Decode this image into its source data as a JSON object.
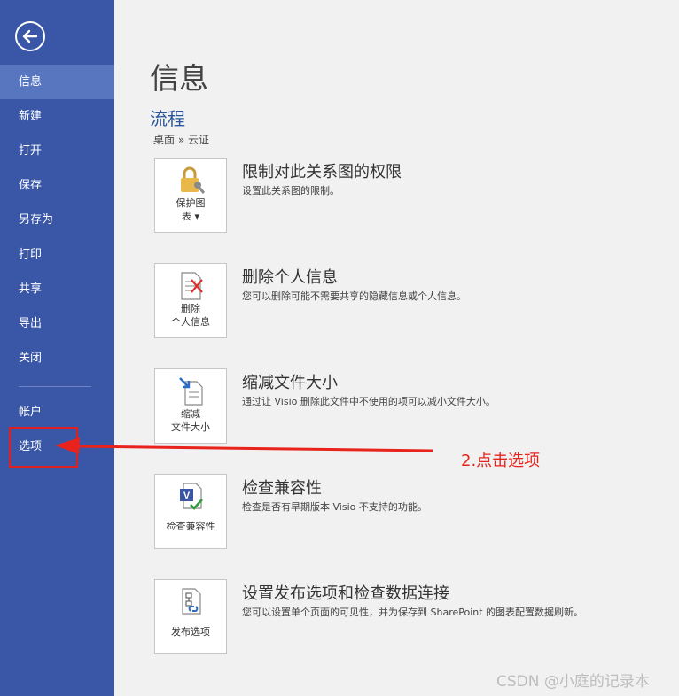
{
  "sidebar": {
    "items": [
      {
        "label": "信息"
      },
      {
        "label": "新建"
      },
      {
        "label": "打开"
      },
      {
        "label": "保存"
      },
      {
        "label": "另存为"
      },
      {
        "label": "打印"
      },
      {
        "label": "共享"
      },
      {
        "label": "导出"
      },
      {
        "label": "关闭"
      },
      {
        "label": "帐户"
      },
      {
        "label": "选项"
      }
    ],
    "active_index": 0
  },
  "main": {
    "page_title": "信息",
    "doc_title": "流程",
    "breadcrumb": "桌面 » 云证",
    "sections": [
      {
        "tile_label_1": "保护图",
        "tile_label_2": "表 ▾",
        "icon": "lock-key-icon",
        "title": "限制对此关系图的权限",
        "desc": "设置此关系图的限制。"
      },
      {
        "tile_label_1": "删除",
        "tile_label_2": "个人信息",
        "icon": "remove-personal-info-icon",
        "title": "删除个人信息",
        "desc": "您可以删除可能不需要共享的隐藏信息或个人信息。"
      },
      {
        "tile_label_1": "缩减",
        "tile_label_2": "文件大小",
        "icon": "reduce-file-size-icon",
        "title": "缩减文件大小",
        "desc": "通过让 Visio 删除此文件中不使用的项可以减小文件大小。"
      },
      {
        "tile_label_1": "检查兼容性",
        "tile_label_2": "",
        "icon": "check-compatibility-icon",
        "title": "检查兼容性",
        "desc": "检查是否有早期版本 Visio 不支持的功能。"
      },
      {
        "tile_label_1": "发布选项",
        "tile_label_2": "",
        "icon": "publish-options-icon",
        "title": "设置发布选项和检查数据连接",
        "desc": "您可以设置单个页面的可见性，并为保存到 SharePoint 的图表配置数据刷新。"
      }
    ]
  },
  "annotation": {
    "text": "2.点击选项"
  },
  "watermark": "CSDN @小庭的记录本",
  "colors": {
    "sidebar": "#3a57a7",
    "active": "#5876c0",
    "accent": "#2b579a",
    "annotation": "#e8231c"
  }
}
